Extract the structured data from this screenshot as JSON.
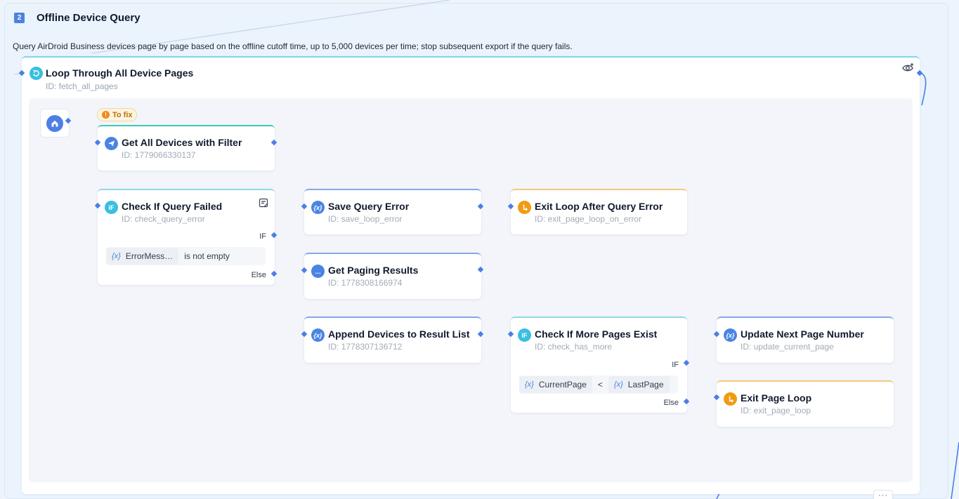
{
  "group": {
    "step": "2",
    "title": "Offline Device Query",
    "description": "Query AirDroid Business devices page by page based on the offline cutoff time, up to 5,000 devices per time; stop subsequent export if the query fails."
  },
  "loop": {
    "title": "Loop Through All Device Pages",
    "id": "ID: fetch_all_pages",
    "icon": "loop-icon"
  },
  "badge": {
    "label": "To fix",
    "icon": "warning-icon"
  },
  "nodes": {
    "get_devices": {
      "title": "Get All Devices with Filter",
      "id": "ID: 1779066330137",
      "icon": "send-icon"
    },
    "check_failed": {
      "title": "Check If Query Failed",
      "id": "ID: check_query_error",
      "icon": "if-icon",
      "if_label": "IF",
      "else_label": "Else",
      "cond_var": "ErrorMess…",
      "cond_op": "is not empty"
    },
    "save_error": {
      "title": "Save Query Error",
      "id": "ID: save_loop_error",
      "icon": "variable-icon"
    },
    "exit_on_error": {
      "title": "Exit Loop After Query Error",
      "id": "ID: exit_page_loop_on_error",
      "icon": "exit-icon"
    },
    "paging_results": {
      "title": "Get Paging Results",
      "id": "ID: 1778308166974",
      "icon": "code-block-icon"
    },
    "append_devices": {
      "title": "Append Devices to Result List",
      "id": "ID: 1778307136712",
      "icon": "variable-icon"
    },
    "check_more": {
      "title": "Check If More Pages Exist",
      "id": "ID: check_has_more",
      "icon": "if-icon",
      "if_label": "IF",
      "else_label": "Else",
      "cond_left": "CurrentPage",
      "cond_op": "<",
      "cond_right": "LastPage"
    },
    "update_page": {
      "title": "Update Next Page Number",
      "id": "ID: update_current_page",
      "icon": "variable-icon"
    },
    "exit_loop": {
      "title": "Exit Page Loop",
      "id": "ID: exit_page_loop",
      "icon": "exit-icon"
    }
  },
  "icons": {
    "var_glyph": "{x}",
    "if_glyph": "IF",
    "more_glyph": "…",
    "menu_glyph": "···"
  },
  "colors": {
    "accent_blue": "#4a84e3",
    "teal": "#39bfe0",
    "orange": "#f19a14",
    "canvas": "#ebf3fc"
  }
}
